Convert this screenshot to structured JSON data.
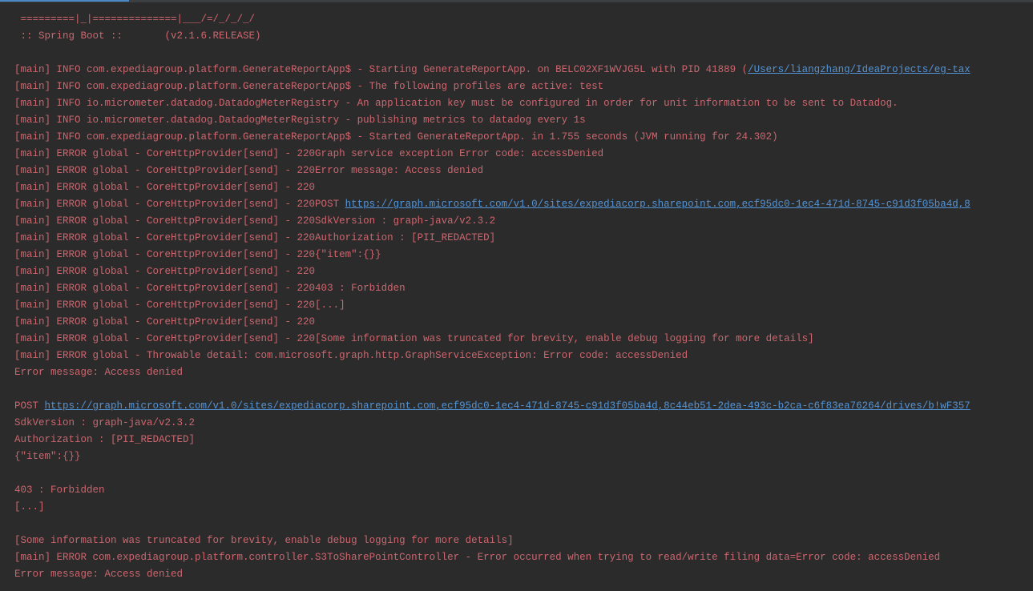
{
  "ascii": {
    "line1": " =========|_|==============|___/=/_/_/_/",
    "line2": " :: Spring Boot ::       (v2.1.6.RELEASE)"
  },
  "lines": [
    {
      "type": "plain",
      "prefix": "[main] INFO com.expediagroup.platform.GenerateReportApp$ - Starting GenerateReportApp. on BELC02XF1WVJG5L with PID 41889 (",
      "link": "/Users/liangzhang/IdeaProjects/eg-tax",
      "suffix": ""
    },
    {
      "type": "plain",
      "text": "[main] INFO com.expediagroup.platform.GenerateReportApp$ - The following profiles are active: test"
    },
    {
      "type": "plain",
      "text": "[main] INFO io.micrometer.datadog.DatadogMeterRegistry - An application key must be configured in order for unit information to be sent to Datadog."
    },
    {
      "type": "plain",
      "text": "[main] INFO io.micrometer.datadog.DatadogMeterRegistry - publishing metrics to datadog every 1s"
    },
    {
      "type": "plain",
      "text": "[main] INFO com.expediagroup.platform.GenerateReportApp$ - Started GenerateReportApp. in 1.755 seconds (JVM running for 24.302)"
    },
    {
      "type": "plain",
      "text": "[main] ERROR global - CoreHttpProvider[send] - 220Graph service exception Error code: accessDenied"
    },
    {
      "type": "plain",
      "text": "[main] ERROR global - CoreHttpProvider[send] - 220Error message: Access denied"
    },
    {
      "type": "plain",
      "text": "[main] ERROR global - CoreHttpProvider[send] - 220"
    },
    {
      "type": "plain",
      "prefix": "[main] ERROR global - CoreHttpProvider[send] - 220POST ",
      "link": "https://graph.microsoft.com/v1.0/sites/expediacorp.sharepoint.com,ecf95dc0-1ec4-471d-8745-c91d3f05ba4d,8",
      "suffix": ""
    },
    {
      "type": "plain",
      "text": "[main] ERROR global - CoreHttpProvider[send] - 220SdkVersion : graph-java/v2.3.2"
    },
    {
      "type": "plain",
      "text": "[main] ERROR global - CoreHttpProvider[send] - 220Authorization : [PII_REDACTED]"
    },
    {
      "type": "plain",
      "text": "[main] ERROR global - CoreHttpProvider[send] - 220{\"item\":{}}"
    },
    {
      "type": "plain",
      "text": "[main] ERROR global - CoreHttpProvider[send] - 220"
    },
    {
      "type": "plain",
      "text": "[main] ERROR global - CoreHttpProvider[send] - 220403 : Forbidden"
    },
    {
      "type": "plain",
      "text": "[main] ERROR global - CoreHttpProvider[send] - 220[...]"
    },
    {
      "type": "plain",
      "text": "[main] ERROR global - CoreHttpProvider[send] - 220"
    },
    {
      "type": "plain",
      "text": "[main] ERROR global - CoreHttpProvider[send] - 220[Some information was truncated for brevity, enable debug logging for more details]"
    },
    {
      "type": "plain",
      "text": "[main] ERROR global - Throwable detail: com.microsoft.graph.http.GraphServiceException: Error code: accessDenied"
    },
    {
      "type": "plain",
      "text": "Error message: Access denied"
    },
    {
      "type": "plain",
      "text": ""
    },
    {
      "type": "plain",
      "prefix": "POST ",
      "link": "https://graph.microsoft.com/v1.0/sites/expediacorp.sharepoint.com,ecf95dc0-1ec4-471d-8745-c91d3f05ba4d,8c44eb51-2dea-493c-b2ca-c6f83ea76264/drives/b!wF357",
      "suffix": ""
    },
    {
      "type": "plain",
      "text": "SdkVersion : graph-java/v2.3.2"
    },
    {
      "type": "plain",
      "text": "Authorization : [PII_REDACTED]"
    },
    {
      "type": "plain",
      "text": "{\"item\":{}}"
    },
    {
      "type": "plain",
      "text": ""
    },
    {
      "type": "plain",
      "text": "403 : Forbidden"
    },
    {
      "type": "plain",
      "text": "[...]"
    },
    {
      "type": "plain",
      "text": ""
    },
    {
      "type": "plain",
      "text": "[Some information was truncated for brevity, enable debug logging for more details]"
    },
    {
      "type": "plain",
      "text": "[main] ERROR com.expediagroup.platform.controller.S3ToSharePointController - Error occurred when trying to read/write filing data=Error code: accessDenied"
    },
    {
      "type": "plain",
      "text": "Error message: Access denied"
    }
  ]
}
